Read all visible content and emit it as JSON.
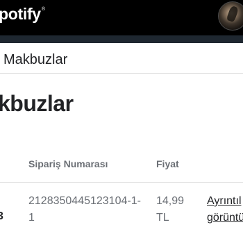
{
  "header": {
    "logo_text": "potify",
    "logo_mark": "®"
  },
  "breadcrumb": {
    "current": "Makbuzlar"
  },
  "page": {
    "title": "kbuzlar"
  },
  "table": {
    "columns": [
      "Sipariş Numarası",
      "Fiyat"
    ],
    "rows": [
      {
        "first_cell": "3",
        "order_number": "2128350445123104-1-1",
        "price": "14,99 TL",
        "link": "Ayrıntıl görüntü"
      }
    ]
  },
  "colors": {
    "topbar": "#000000",
    "subbar": "#1e2730",
    "text": "#222326",
    "muted": "#6b6f75"
  }
}
